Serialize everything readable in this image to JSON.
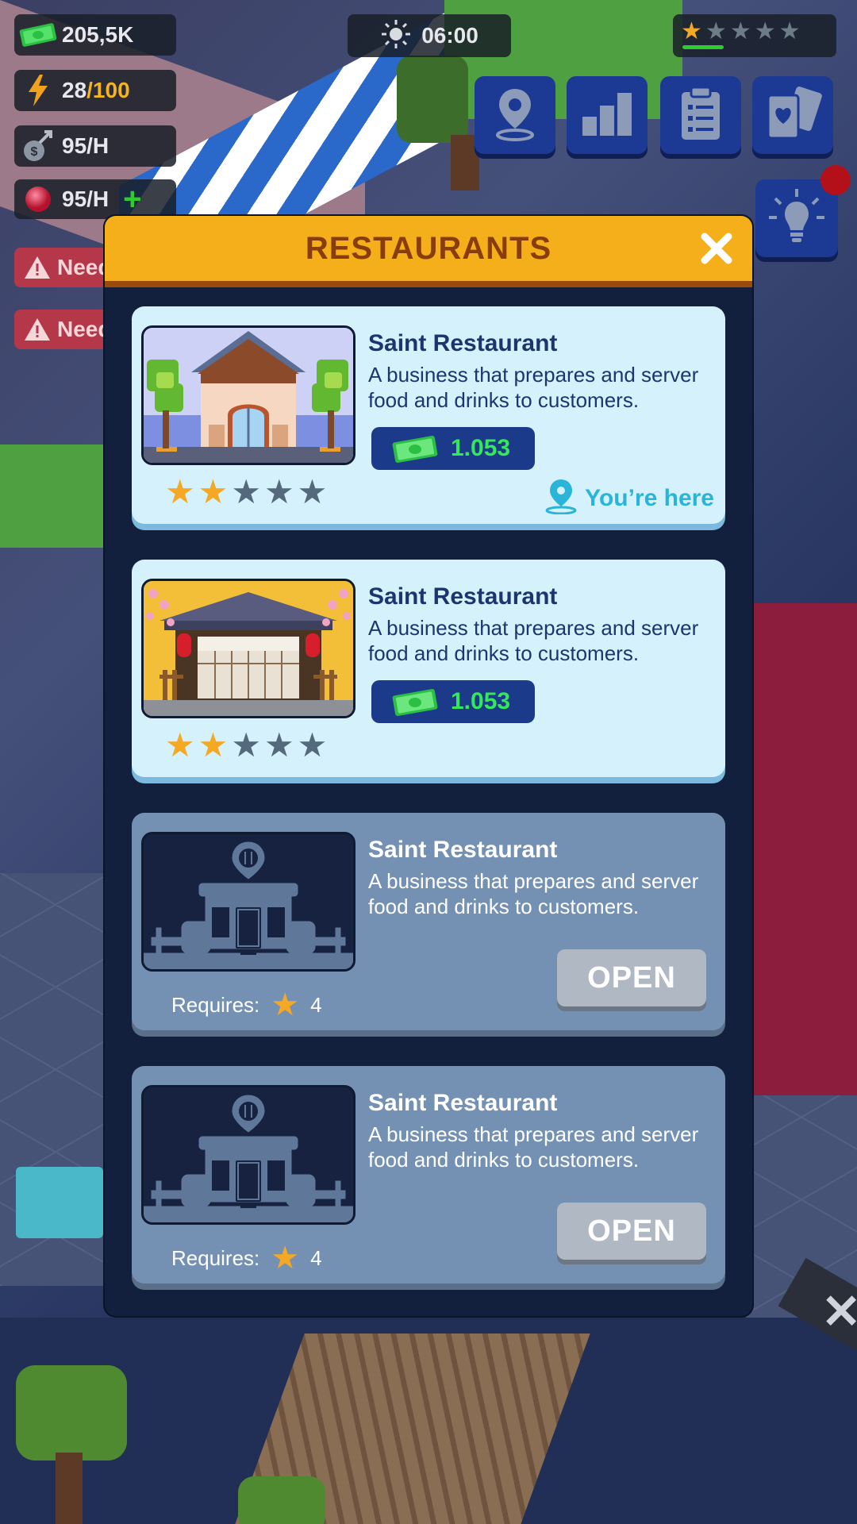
{
  "hud": {
    "money": "205,5K",
    "energy_current": "28",
    "energy_max": "/100",
    "income_rate": "95/H",
    "gems_rate": "95/H",
    "time": "06:00",
    "rating_stars": 1,
    "rating_max": 5,
    "need_alert_1": "Need",
    "need_alert_2": "Need"
  },
  "nav": {
    "icons": [
      "map-pin-icon",
      "stats-icon",
      "clipboard-icon",
      "cards-icon",
      "lightbulb-icon"
    ]
  },
  "modal": {
    "title": "RESTAURANTS",
    "cards": [
      {
        "title": "Saint Restaurant",
        "description": "A business that prepares and server food and drinks to customers.",
        "price": "1.053",
        "stars": 2,
        "stars_max": 5,
        "status": "You’re here",
        "thumb": "western-restaurant"
      },
      {
        "title": "Saint Restaurant",
        "description": "A business that prepares and server food and drinks to customers.",
        "price": "1.053",
        "stars": 2,
        "stars_max": 5,
        "thumb": "japanese-restaurant"
      },
      {
        "title": "Saint Restaurant",
        "description": "A business that prepares and server food and drinks to customers.",
        "requires_label": "Requires:",
        "requires_value": "4",
        "open_label": "OPEN",
        "thumb": "locked-restaurant"
      },
      {
        "title": "Saint Restaurant",
        "description": "A business that prepares and server food and drinks to customers.",
        "requires_label": "Requires:",
        "requires_value": "4",
        "open_label": "OPEN",
        "thumb": "locked-restaurant"
      }
    ]
  },
  "colors": {
    "modal_header": "#f5af1b",
    "modal_body": "#13203d",
    "card_active": "#d5f1fb",
    "card_locked": "#7491b3",
    "price_green": "#34e85a",
    "star_gold": "#f4a823"
  }
}
